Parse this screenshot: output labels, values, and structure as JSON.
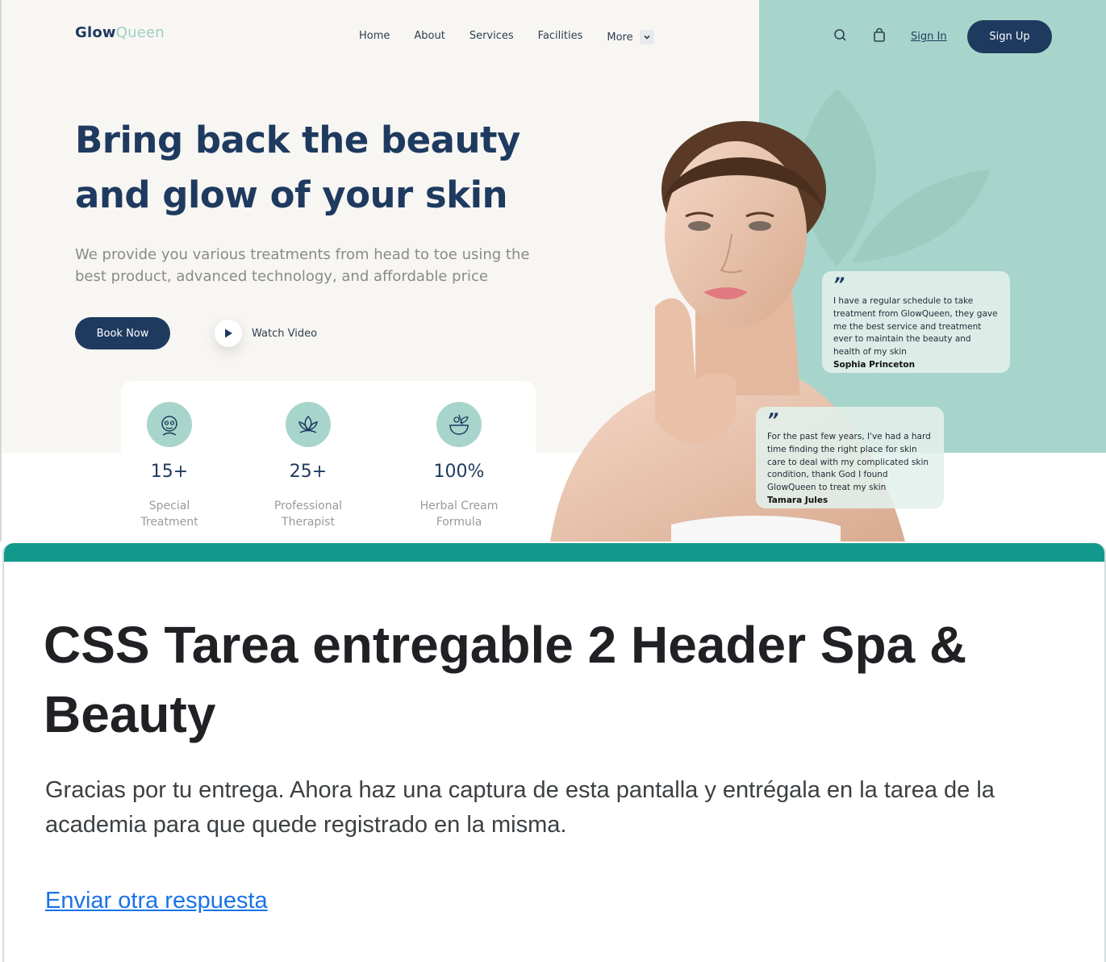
{
  "site": {
    "logo": {
      "part1": "Glow",
      "part2": "Queen"
    },
    "nav": [
      "Home",
      "About",
      "Services",
      "Facilities",
      "More"
    ],
    "icons": {
      "search": "search-icon",
      "cart": "shopping-bag-icon",
      "more_toggle": "chevron-down-icon",
      "play": "play-icon"
    },
    "auth": {
      "signin": "Sign In",
      "signup": "Sign Up"
    },
    "hero": {
      "title_line1": "Bring back the beauty",
      "title_line2": "and glow of your skin",
      "subtitle": "We provide you various treatments from head to toe using the best product, advanced technology, and affordable price",
      "book_label": "Book Now",
      "watch_label": "Watch Video"
    },
    "stats": [
      {
        "icon": "face-mask-icon",
        "value": "15+",
        "label_line1": "Special",
        "label_line2": "Treatment"
      },
      {
        "icon": "lotus-icon",
        "value": "25+",
        "label_line1": "Professional",
        "label_line2": "Therapist"
      },
      {
        "icon": "herbal-bowl-icon",
        "value": "100%",
        "label_line1": "Herbal Cream",
        "label_line2": "Formula"
      }
    ],
    "testimonials": [
      {
        "quote_mark": "”",
        "lines": [
          "I have a regular schedule to take",
          "treatment from GlowQueen, they gave",
          "me the best service and treatment",
          "ever to maintain the beauty and",
          "health of my skin"
        ],
        "author": "Sophia Princeton"
      },
      {
        "quote_mark": "”",
        "lines": [
          "For the past few years, I've had a hard",
          "time finding the right place for skin",
          "care to deal with my complicated skin",
          "condition, thank God I found",
          "GlowQueen to treat my skin"
        ],
        "author": "Tamara Jules"
      }
    ],
    "colors": {
      "navy": "#1e3a5f",
      "mint": "#a8d5cb",
      "cream": "#f8f6f3"
    }
  },
  "form": {
    "title": "CSS Tarea entregable 2 Header Spa & Beauty",
    "message": "Gracias por tu entrega. Ahora haz una captura de esta pantalla y entrégala en la tarea de la academia para que quede registrado en la misma.",
    "link": "Enviar otra respuesta",
    "accent": "#12998c"
  }
}
